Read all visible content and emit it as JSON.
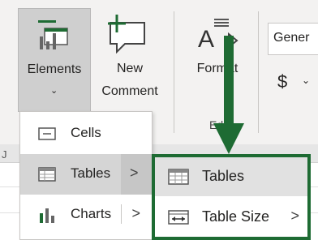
{
  "ribbon": {
    "elements_button": {
      "label": "Elements",
      "caret": "⌄",
      "icon": "elements-icon"
    },
    "new_comment_button": {
      "label_line1": "New",
      "label_line2": "Comment",
      "icon": "new-comment-icon"
    },
    "format_button": {
      "label": "Format",
      "icon": "format-painter-icon"
    },
    "group_label_fragment": "Ed",
    "number_format": {
      "value": "Gener",
      "currency_symbol": "$",
      "currency_caret": "⌄"
    }
  },
  "sheet": {
    "column_letter": "J"
  },
  "elements_menu": {
    "items": [
      {
        "label": "Cells",
        "icon": "cell-icon",
        "has_submenu": false,
        "selected": false
      },
      {
        "label": "Tables",
        "icon": "table-icon",
        "has_submenu": true,
        "selected": true
      },
      {
        "label": "Charts",
        "icon": "chart-icon",
        "has_submenu": true,
        "selected": false
      }
    ],
    "chevron": ">"
  },
  "tables_submenu": {
    "items": [
      {
        "label": "Tables",
        "icon": "table-icon",
        "has_submenu": false,
        "selected": true
      },
      {
        "label": "Table Size",
        "icon": "table-size-icon",
        "has_submenu": true,
        "selected": false
      }
    ],
    "chevron": ">"
  },
  "annotation": {
    "arrow_color": "#1e6b33",
    "highlight_color": "#1e6b33"
  }
}
